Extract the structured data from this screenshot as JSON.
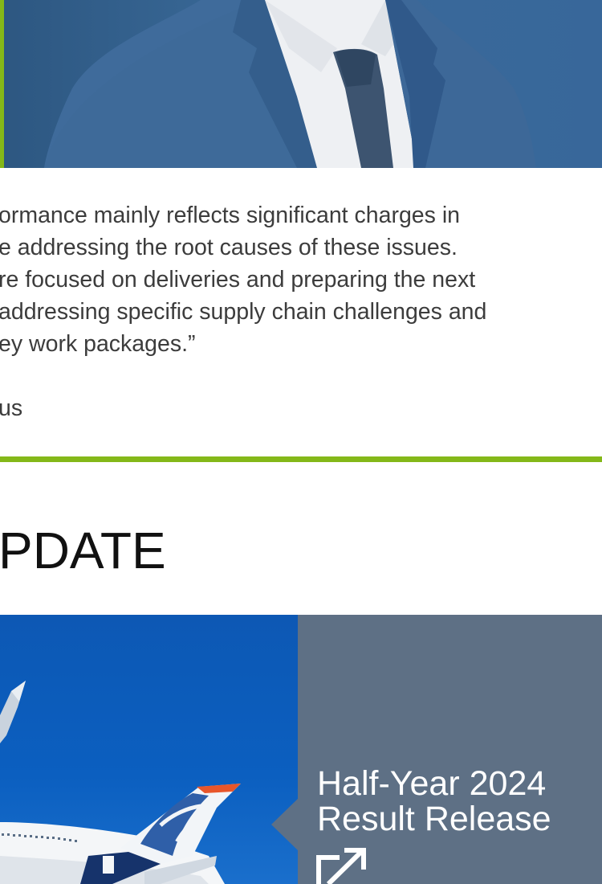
{
  "hero": {
    "accent_color": "#84b819",
    "photo": "portrait-in-suit"
  },
  "quote": {
    "lines": [
      "ormance mainly reflects significant charges in",
      "e addressing the root causes of these issues.",
      "re focused on deliveries and preparing the next",
      " addressing specific supply chain challenges and",
      "ey work packages.”"
    ],
    "attribution": "us"
  },
  "section": {
    "title": "PDATE"
  },
  "promo": {
    "title_line1": "Half-Year 2024",
    "title_line2": "Result Release",
    "icon": "external-link-icon",
    "panel_color": "#5e7085"
  }
}
